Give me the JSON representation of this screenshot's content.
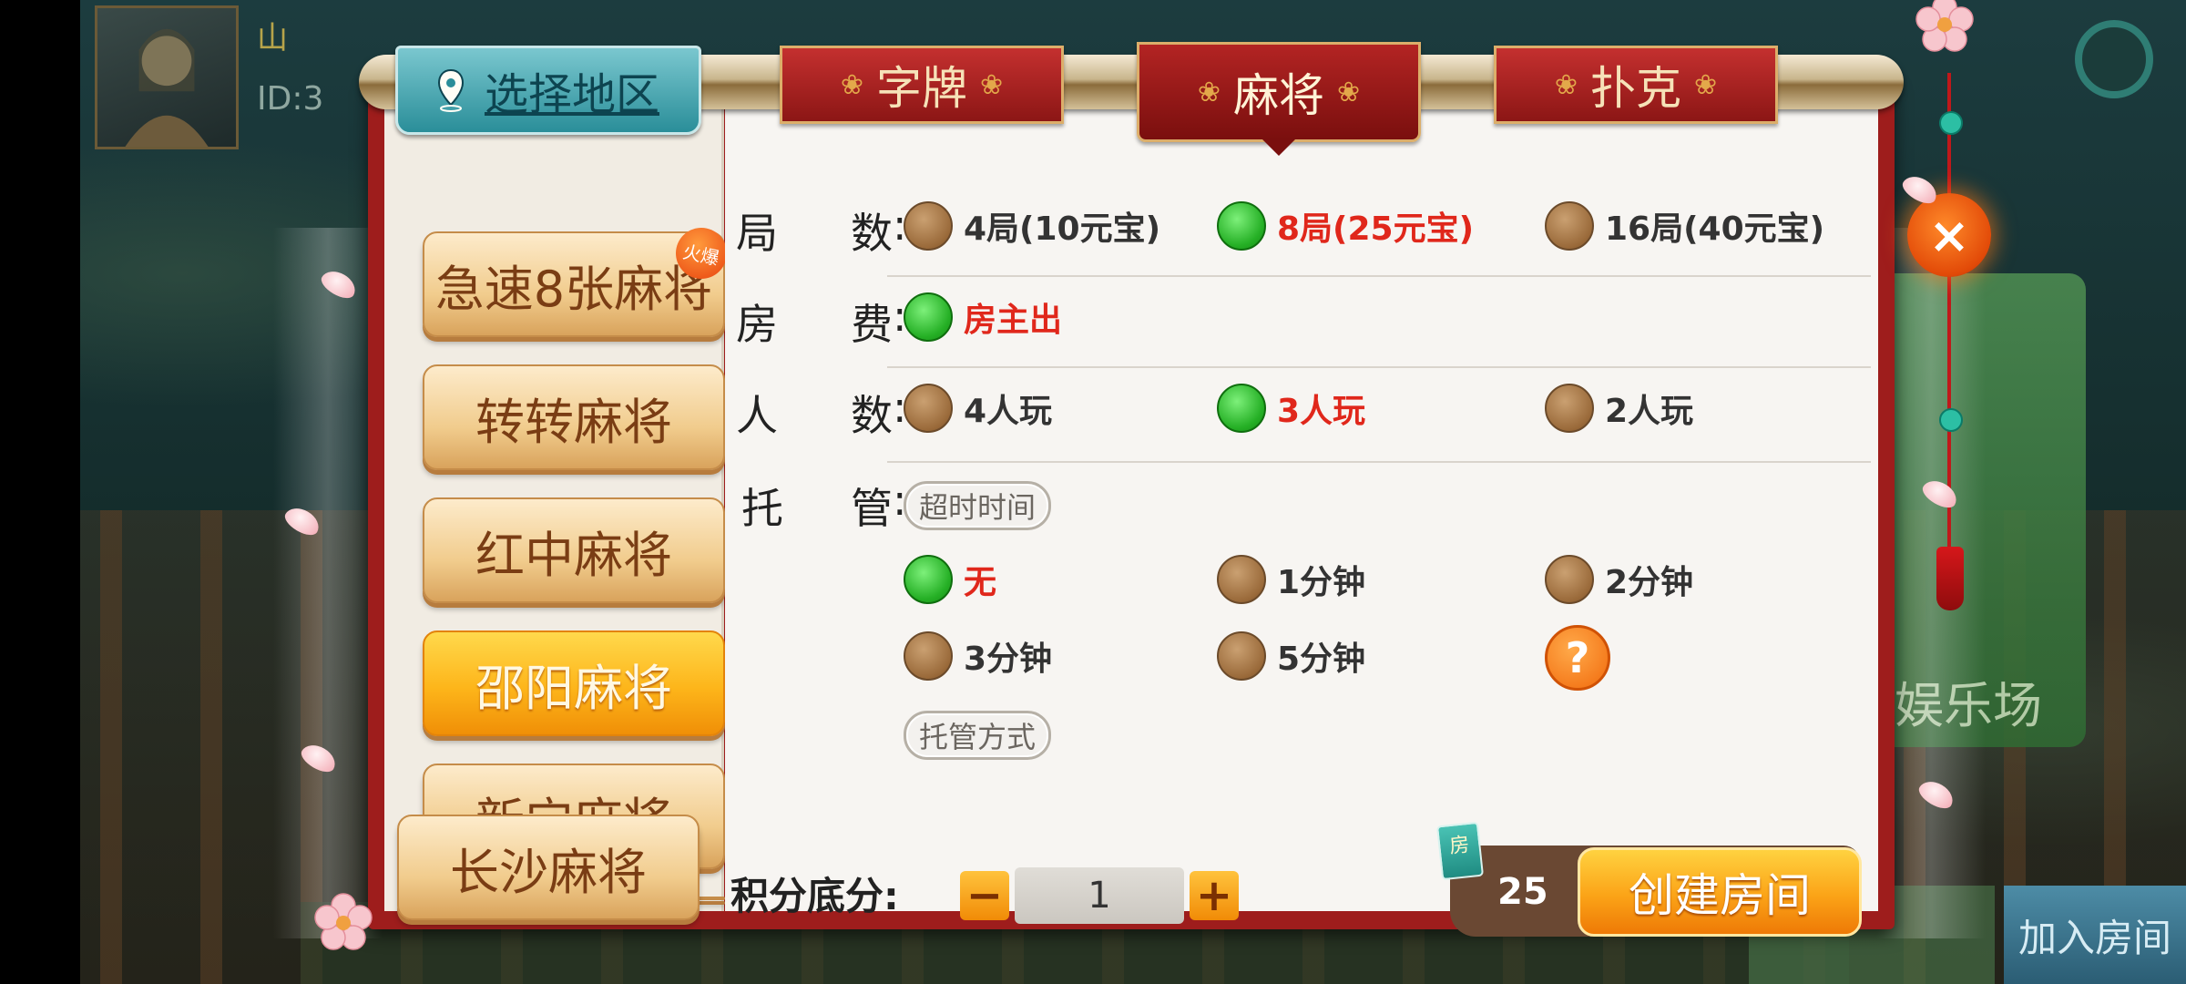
{
  "background": {
    "user_name": "山",
    "user_id": "ID:3",
    "right_card_label": "娱乐场",
    "bottom_join_label": "加入房间",
    "bottom_create_label": "创建房间"
  },
  "region_tab": {
    "label": "选择地区",
    "icon": "location-pin-icon"
  },
  "category_tabs": [
    {
      "label": "字牌",
      "active": false
    },
    {
      "label": "麻将",
      "active": true
    },
    {
      "label": "扑克",
      "active": false
    }
  ],
  "games": [
    {
      "label": "急速8张麻将",
      "active": false,
      "badge": "火爆"
    },
    {
      "label": "转转麻将",
      "active": false
    },
    {
      "label": "红中麻将",
      "active": false
    },
    {
      "label": "邵阳麻将",
      "active": true
    },
    {
      "label": "新宁麻将",
      "active": false
    },
    {
      "label": "长沙麻将",
      "active": false
    }
  ],
  "settings": {
    "rounds": {
      "label_a": "局",
      "label_b": "数",
      "options": [
        {
          "label": "4局(10元宝)",
          "selected": false
        },
        {
          "label": "8局(25元宝)",
          "selected": true
        },
        {
          "label": "16局(40元宝)",
          "selected": false
        }
      ]
    },
    "fee": {
      "label_a": "房",
      "label_b": "费",
      "options": [
        {
          "label": "房主出",
          "selected": true
        }
      ]
    },
    "players": {
      "label_a": "人",
      "label_b": "数",
      "options": [
        {
          "label": "4人玩",
          "selected": false
        },
        {
          "label": "3人玩",
          "selected": true
        },
        {
          "label": "2人玩",
          "selected": false
        }
      ]
    },
    "auto_play": {
      "label_a": "托",
      "label_b": "管",
      "timeout_pill": "超时时间",
      "mode_pill": "托管方式",
      "options": [
        {
          "label": "无",
          "selected": true
        },
        {
          "label": "1分钟",
          "selected": false
        },
        {
          "label": "2分钟",
          "selected": false
        },
        {
          "label": "3分钟",
          "selected": false
        },
        {
          "label": "5分钟",
          "selected": false
        }
      ],
      "help": "?"
    }
  },
  "score": {
    "label": "积分底分:",
    "value": "1",
    "minus": "−",
    "plus": "+"
  },
  "create": {
    "cost": "25",
    "card_label": "房",
    "button": "创建房间"
  },
  "close": {
    "label": "×"
  },
  "colors": {
    "frame": "#9e1d1c",
    "accent_gold": "#fdb51a",
    "selected_green": "#26b026",
    "selected_text": "#e0271b"
  }
}
